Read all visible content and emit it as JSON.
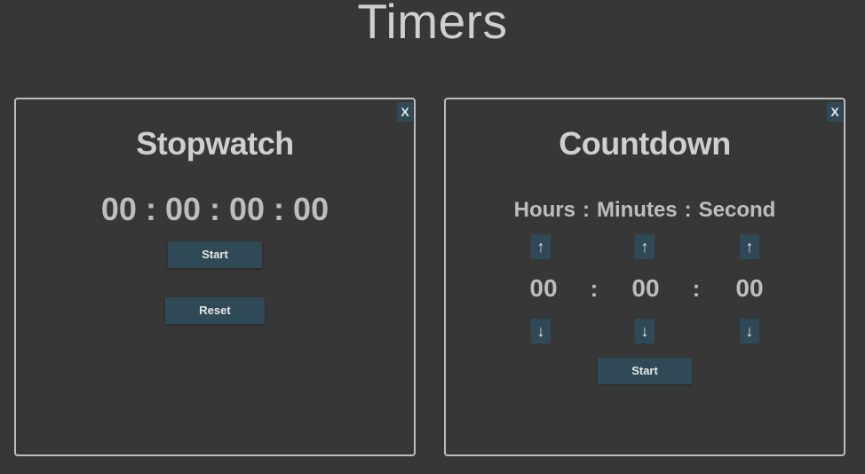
{
  "page": {
    "title": "Timers"
  },
  "stopwatch": {
    "title": "Stopwatch",
    "close_label": "X",
    "display": {
      "hours": "00",
      "minutes": "00",
      "seconds": "00",
      "centiseconds": "00",
      "separator": ":"
    },
    "start_label": "Start",
    "reset_label": "Reset"
  },
  "countdown": {
    "title": "Countdown",
    "close_label": "X",
    "labels": {
      "hours": "Hours",
      "minutes": "Minutes",
      "seconds": "Second",
      "separator": ":"
    },
    "values": {
      "hours": "00",
      "minutes": "00",
      "seconds": "00",
      "separator": ":"
    },
    "up_arrow": "↑",
    "down_arrow": "↓",
    "start_label": "Start"
  },
  "colors": {
    "background": "#373737",
    "panel_border": "#bdbdbd",
    "button_bg": "#2f4a56",
    "text_primary": "#cfcfcf",
    "text_secondary": "#bdbdbd",
    "button_text": "#e6e6e6"
  },
  "icons": {
    "up": "arrow-up-icon",
    "down": "arrow-down-icon"
  }
}
